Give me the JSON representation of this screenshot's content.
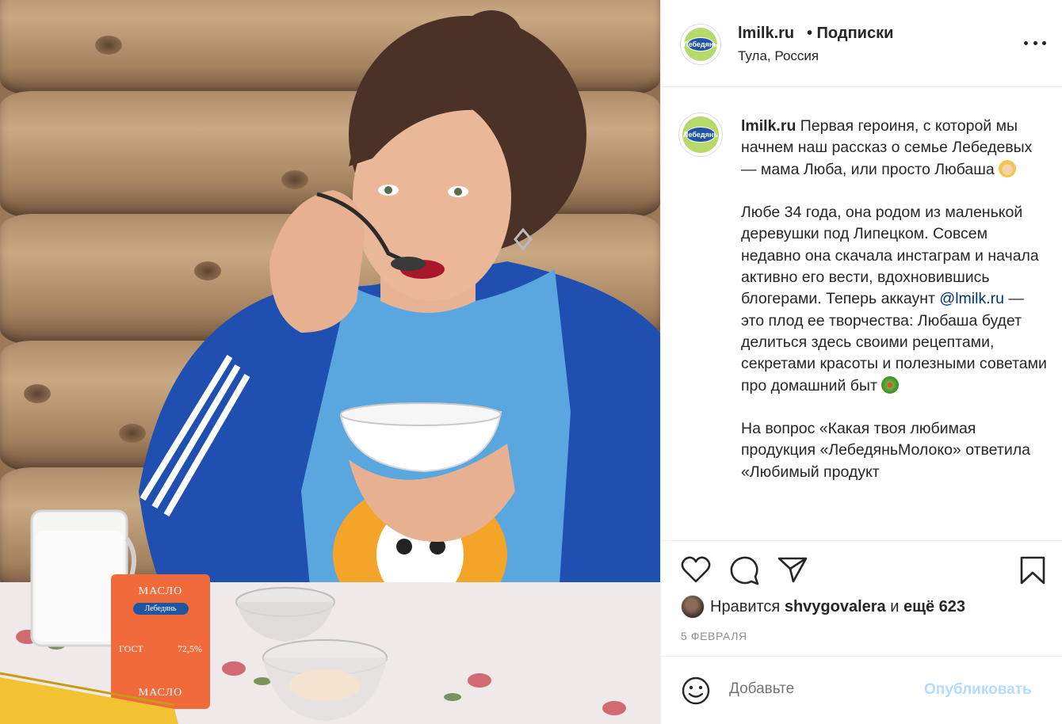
{
  "post": {
    "username": "lmilk.ru",
    "follow_label": "• Подписки",
    "location": "Тула, Россия",
    "avatar_text": "Лебедянь",
    "caption": {
      "username": "lmilk.ru",
      "p1_text": "Первая героиня, с которой мы начнем наш рассказ о семье Лебедевых — мама Люба, или просто Любаша",
      "p1_emoji": "woman-emoji",
      "p2_before": "Любе 34 года, она родом из маленькой деревушки под Липецком. Совсем недавно она скачала инстаграм и начала активно его вести, вдохновившись блогерами. Теперь аккаунт",
      "p2_mention": "@lmilk.ru",
      "p2_after": "— это плод ее творчества: Любаша будет делиться здесь своими рецептами, секретами красоты и полезными советами про домашний быт",
      "p2_emoji": "salad-emoji",
      "p3_text": "На вопрос «Какая твоя любимая продукция «ЛебедяньМолоко» ответила «Любимый продукт"
    },
    "likes": {
      "prefix": "Нравится",
      "user": "shvygovalera",
      "middle": "и",
      "rest": "ещё 623"
    },
    "date": "5 ФЕВРАЛЯ",
    "comment": {
      "placeholder": "Добавьте",
      "publish_label": "Опубликовать"
    }
  },
  "photo": {
    "butter_pack_top": "МАСЛО",
    "butter_pack_brand": "Лебедянь",
    "butter_pack_gost": "ГОСТ",
    "butter_pack_fat": "72,5%",
    "butter_pack_bottom": "МАСЛО"
  },
  "colors": {
    "mention": "#00376b",
    "publish_disabled": "#b3dbff",
    "brand_blue": "#1e56a3",
    "brand_green": "#b6d96a"
  }
}
